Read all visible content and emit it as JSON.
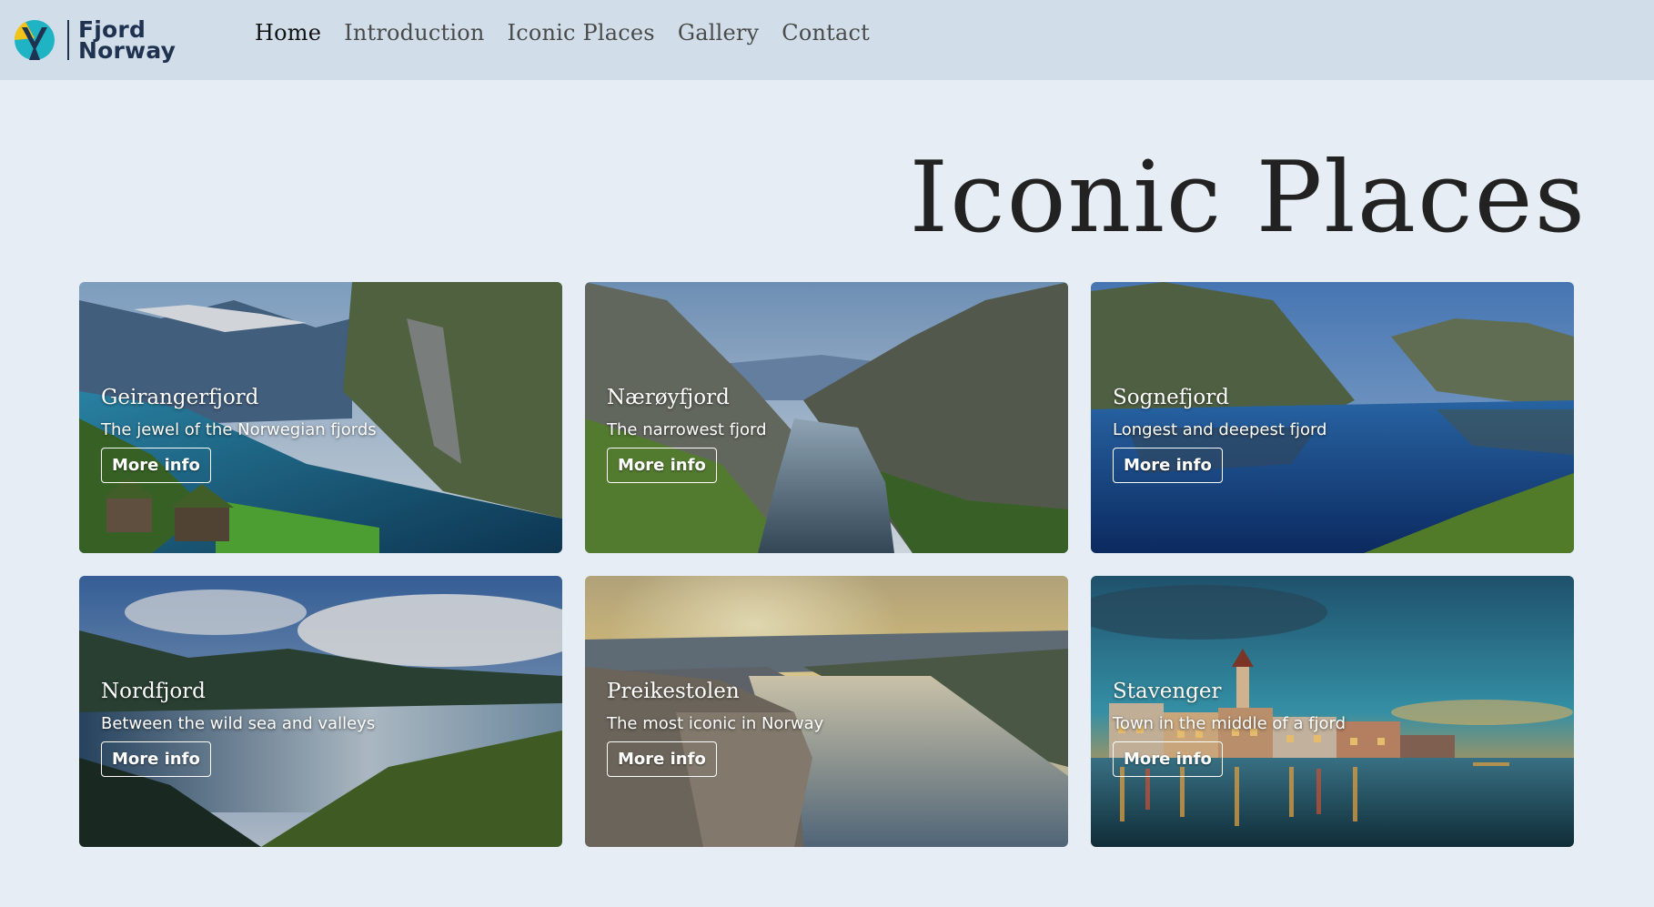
{
  "brand": {
    "line1": "Fjord",
    "line2": "Norway",
    "colors": {
      "primary": "#1f3350",
      "accent_teal": "#1fb3c4",
      "accent_yellow": "#f2c318"
    }
  },
  "nav": {
    "items": [
      {
        "label": "Home",
        "active": true
      },
      {
        "label": "Introduction",
        "active": false
      },
      {
        "label": "Iconic Places",
        "active": false
      },
      {
        "label": "Gallery",
        "active": false
      },
      {
        "label": "Contact",
        "active": false
      }
    ]
  },
  "page": {
    "title": "Iconic Places"
  },
  "cards": [
    {
      "title": "Geirangerfjord",
      "subtitle": "The jewel of the Norwegian fjords",
      "button": "More info"
    },
    {
      "title": "Nærøyfjord",
      "subtitle": "The narrowest fjord",
      "button": "More info"
    },
    {
      "title": "Sognefjord",
      "subtitle": "Longest and deepest fjord",
      "button": "More info"
    },
    {
      "title": "Nordfjord",
      "subtitle": "Between the wild sea and valleys",
      "button": "More info"
    },
    {
      "title": "Preikestolen",
      "subtitle": "The most iconic in Norway",
      "button": "More info"
    },
    {
      "title": "Stavenger",
      "subtitle": "Town in the middle of a fjord",
      "button": "More info"
    }
  ],
  "colors": {
    "background": "#e6edf4",
    "header": "#d1dee9",
    "text": "#222222"
  }
}
